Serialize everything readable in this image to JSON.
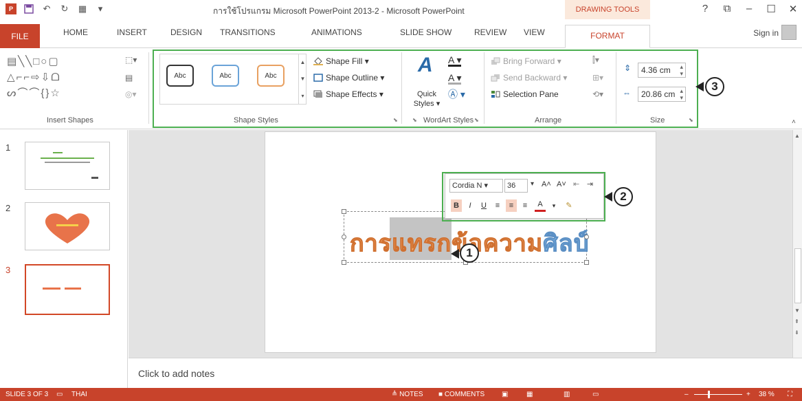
{
  "titlebar": {
    "title": "การใช้โปรแกรม Microsoft PowerPoint 2013-2 - Microsoft PowerPoint",
    "contextual_group": "DRAWING TOOLS",
    "help": "?",
    "restore": "⧉",
    "minimize": "–",
    "maximize": "☐",
    "close": "✕"
  },
  "tabs": {
    "file": "FILE",
    "home": "HOME",
    "insert": "INSERT",
    "design": "DESIGN",
    "transitions": "TRANSITIONS",
    "animations": "ANIMATIONS",
    "slideshow": "SLIDE SHOW",
    "review": "REVIEW",
    "view": "VIEW",
    "format": "FORMAT",
    "sign_in": "Sign in"
  },
  "ribbon": {
    "insert_shapes_label": "Insert Shapes",
    "shapes_row1": "▤╲╲□○▢",
    "shapes_row2": "△⌐⌐⇨⇩ᗝ",
    "shapes_row3": "ᔕ⌒⌒{}☆",
    "shape_styles_label": "Shape Styles",
    "style_box_text": "Abc",
    "shape_fill": "Shape Fill ▾",
    "shape_outline": "Shape Outline ▾",
    "shape_effects": "Shape Effects ▾",
    "quick_styles": "Quick Styles ▾",
    "wordart_label": "WordArt Styles",
    "bring_forward": "Bring Forward ▾",
    "send_backward": "Send Backward ▾",
    "selection_pane": "Selection Pane",
    "arrange_label": "Arrange",
    "height_value": "4.36 cm",
    "width_value": "20.86 cm",
    "size_label": "Size"
  },
  "callouts": {
    "one": "1",
    "two": "2",
    "three": "3"
  },
  "slides": [
    {
      "number": "1"
    },
    {
      "number": "2"
    },
    {
      "number": "3"
    }
  ],
  "slide_text": {
    "part1": "การแทรก",
    "part2": "ข้อ",
    "part3": "ความ",
    "part4": "ศิลป์"
  },
  "mini_toolbar": {
    "font": "Cordia N ▾",
    "size": "36",
    "grow": "A˄",
    "shrink": "A˅",
    "bold": "B",
    "italic": "I",
    "underline": "U",
    "font_color": "A"
  },
  "notes": {
    "placeholder": "Click to add notes"
  },
  "status": {
    "slide_counter": "SLIDE 3 OF 3",
    "language": "THAI",
    "notes": "≜ NOTES",
    "comments": "■ COMMENTS",
    "zoom": "38 %"
  },
  "colors": {
    "accent": "#c8432b",
    "highlight_box": "#4caf50",
    "wordart_orange": "#f0a060",
    "wordart_blue": "#7fb4e0"
  }
}
